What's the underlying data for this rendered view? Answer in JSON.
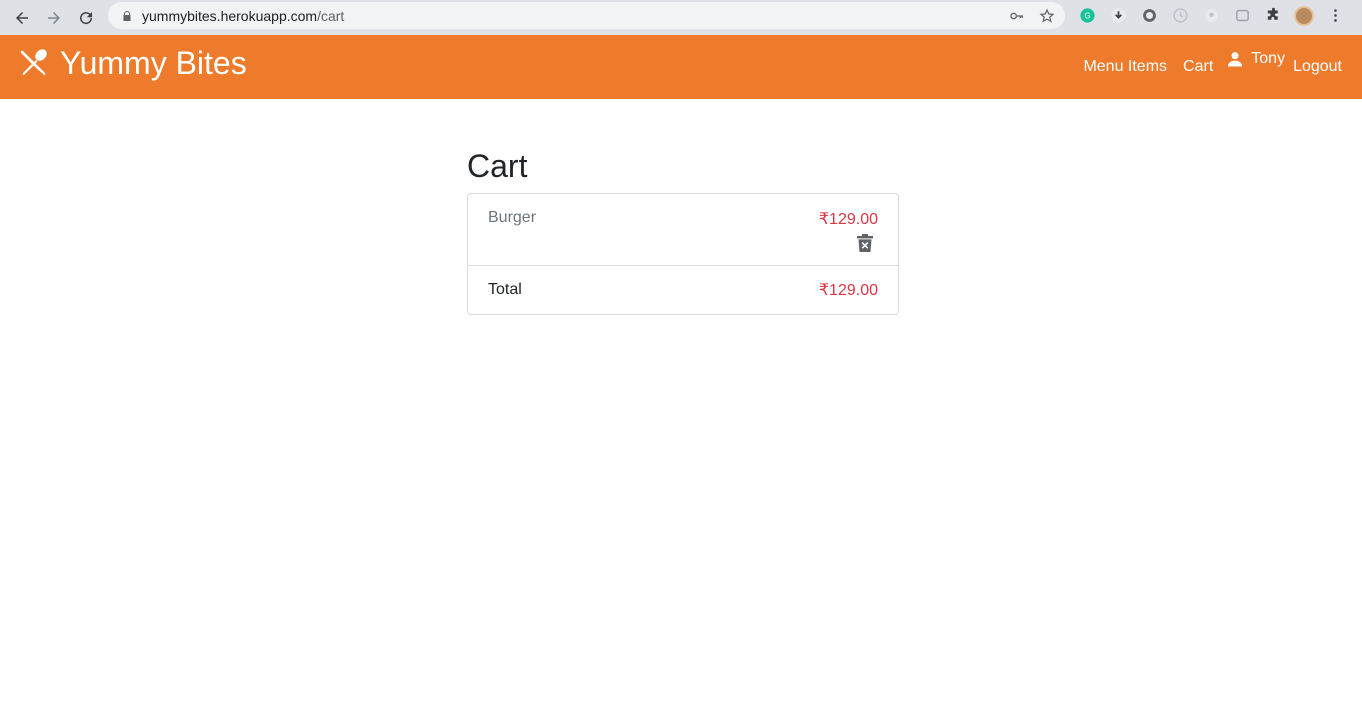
{
  "browser": {
    "url_host": "yummybites.herokuapp.com",
    "url_path": "/cart"
  },
  "navbar": {
    "brand": "Yummy Bites",
    "links": {
      "menu_items": "Menu Items",
      "cart": "Cart",
      "user": "Tony",
      "logout": "Logout"
    },
    "color": "#ee7b2c"
  },
  "page": {
    "title": "Cart"
  },
  "cart": {
    "items": [
      {
        "name": "Burger",
        "price": "₹129.00"
      }
    ],
    "total_label": "Total",
    "total_value": "₹129.00"
  },
  "icons": {
    "brand": "utensils-icon",
    "user": "person-icon",
    "remove": "trash-icon"
  }
}
